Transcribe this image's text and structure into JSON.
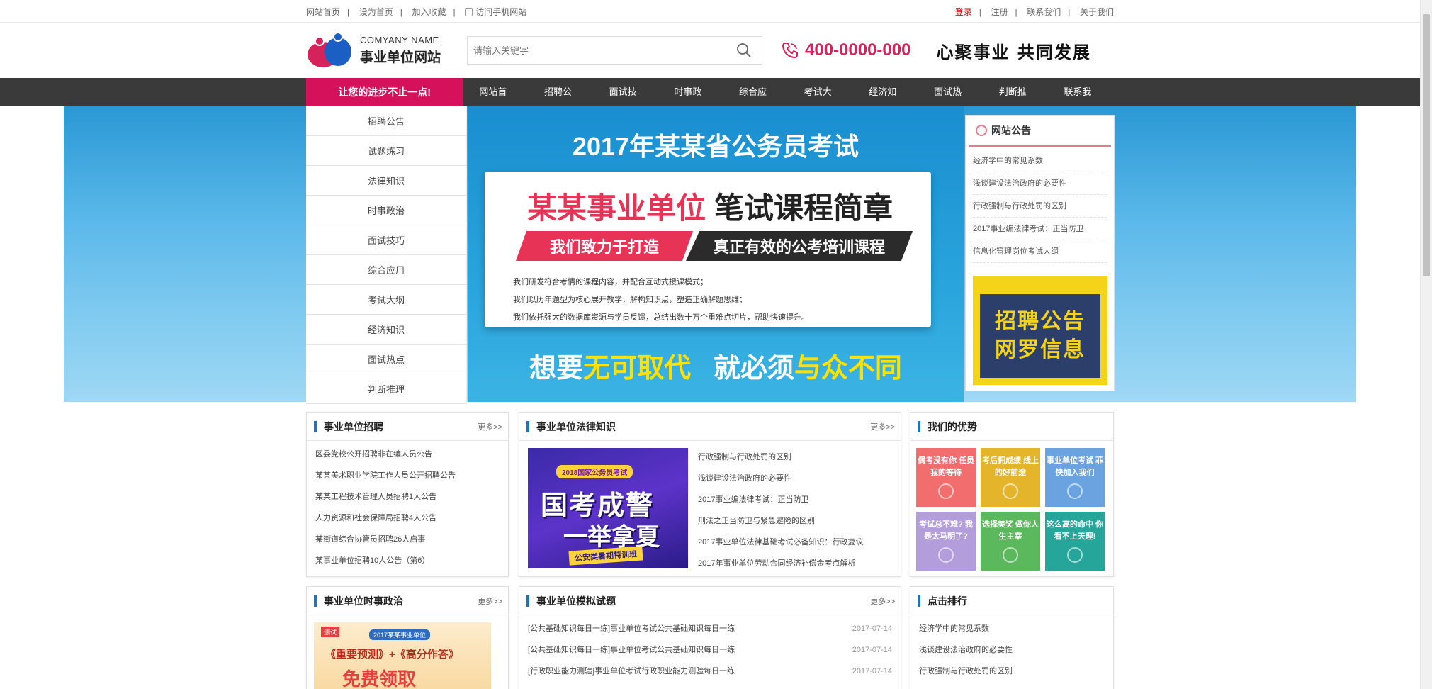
{
  "topbar": {
    "left": [
      "网站首页",
      "设为首页",
      "加入收藏",
      "访问手机网站"
    ],
    "right": [
      "登录",
      "注册",
      "联系我们",
      "关于我们"
    ]
  },
  "header": {
    "company_en": "COMYANY NAME",
    "company_cn": "事业单位网站",
    "search_placeholder": "请输入关键字",
    "phone": "400-0000-000",
    "slogan": "心聚事业 共同发展"
  },
  "nav": {
    "promo": "让您的进步不止一点!",
    "items": [
      "网站首页",
      "招聘公告",
      "面试技巧",
      "时事政治",
      "综合应用",
      "考试大纲",
      "经济知识",
      "面试热点",
      "判断推理",
      "联系我们"
    ]
  },
  "side_menu": [
    "招聘公告",
    "试题练习",
    "法律知识",
    "时事政治",
    "面试技巧",
    "综合应用",
    "考试大纲",
    "经济知识",
    "面试热点",
    "判断推理"
  ],
  "banner": {
    "title": "2017年某某省公务员考试",
    "card_title_red": "某某事业单位",
    "card_title_black": "笔试课程简章",
    "bar_left": "我们致力于打造",
    "bar_right": "真正有效的公考培训课程",
    "desc": [
      "我们研发符合考情的课程内容，并配合互动式授课模式；",
      "我们以历年题型为核心展开教学，解构知识点，塑造正确解题思维；",
      "我们依托强大的数据库资源与学员反馈，总结出数十万个重难点切片，帮助快速提升。"
    ],
    "bottom_1": "想要",
    "bottom_2": "无可取代",
    "bottom_3": "就必须",
    "bottom_4": "与众不同"
  },
  "notice": {
    "title": "网站公告",
    "items": [
      "经济学中的常见系数",
      "浅谈建设法治政府的必要性",
      "行政强制与行政处罚的区别",
      "2017事业编法律考试：正当防卫",
      "信息化管理岗位考试大纲"
    ],
    "poster_line1": "招聘公告",
    "poster_line2": "网罗信息"
  },
  "recruit": {
    "title": "事业单位招聘",
    "more": "更多>>",
    "items": [
      "区委党校公开招聘非在编人员公告",
      "某某美术职业学院工作人员公开招聘公告",
      "某某工程技术管理人员招聘1人公告",
      "人力资源和社会保障局招聘4人公告",
      "某街道综合协管员招聘26人启事",
      "某事业单位招聘10人公告（第6）"
    ]
  },
  "legal": {
    "title": "事业单位法律知识",
    "more": "更多>>",
    "img_tag": "2018国家公务员考试",
    "img_l1": "国考成警",
    "img_l2": "一举拿夏",
    "img_l3": "公安类暑期特训班",
    "items": [
      "行政强制与行政处罚的区别",
      "浅谈建设法治政府的必要性",
      "2017事业编法律考试：正当防卫",
      "刑法之正当防卫与紧急避险的区别",
      "2017事业单位法律基础考试必备知识：行政复议",
      "2017年事业单位劳动合同经济补偿金考点解析"
    ]
  },
  "advantage": {
    "title": "我们的优势",
    "tiles": [
      {
        "text": "偶考没有你 任员我的等待",
        "color": "#f26d6d"
      },
      {
        "text": "考后拥成绩 线上的好前途",
        "color": "#e4b52b"
      },
      {
        "text": "事业单位考试 菲快加入我们",
        "color": "#6aa3e0"
      },
      {
        "text": "考试总不难? 我是太马明了?",
        "color": "#b39ddb"
      },
      {
        "text": "选择美奖 做你人生主宰",
        "color": "#5cb85c"
      },
      {
        "text": "这么高的命中 你看不上天理!",
        "color": "#26a69a"
      }
    ]
  },
  "politics": {
    "title": "事业单位时事政治",
    "more": "更多>>",
    "img_tag": "测试",
    "img_sub": "2017某某事业单位",
    "img_mid": "《重要预测》+《高分作答》",
    "img_big": "免费领取"
  },
  "mock": {
    "title": "事业单位模拟试题",
    "more": "更多>>",
    "items": [
      {
        "t": "[公共基础知识每日一练]事业单位考试公共基础知识每日一练",
        "d": "2017-07-14"
      },
      {
        "t": "[公共基础知识每日一练]事业单位考试公共基础知识每日一练",
        "d": "2017-07-14"
      },
      {
        "t": "[行政职业能力测验]事业单位考试行政职业能力测验每日一练",
        "d": "2017-07-14"
      }
    ]
  },
  "ranking": {
    "title": "点击排行",
    "items": [
      "经济学中的常见系数",
      "浅谈建设法治政府的必要性",
      "行政强制与行政处罚的区别"
    ]
  }
}
